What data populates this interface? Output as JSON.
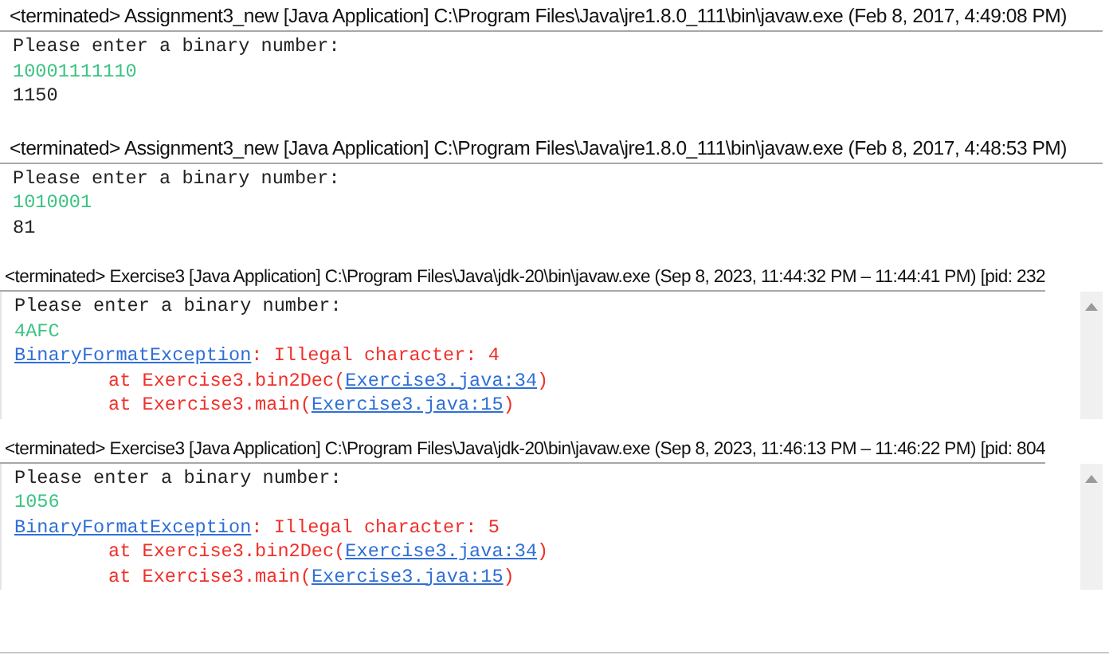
{
  "consoles": [
    {
      "header": "<terminated> Assignment3_new [Java Application] C:\\Program Files\\Java\\jre1.8.0_111\\bin\\javaw.exe (Feb 8, 2017, 4:49:08 PM)",
      "scrollbar": false,
      "lines": [
        {
          "indented": false,
          "segments": [
            {
              "kind": "output",
              "text": "Please enter a binary number:"
            }
          ]
        },
        {
          "indented": false,
          "segments": [
            {
              "kind": "input",
              "text": "10001111110"
            }
          ]
        },
        {
          "indented": false,
          "segments": [
            {
              "kind": "output",
              "text": "1150"
            }
          ]
        }
      ]
    },
    {
      "header": "<terminated> Assignment3_new [Java Application] C:\\Program Files\\Java\\jre1.8.0_111\\bin\\javaw.exe (Feb 8, 2017, 4:48:53 PM)",
      "scrollbar": false,
      "lines": [
        {
          "indented": false,
          "segments": [
            {
              "kind": "output",
              "text": "Please enter a binary number:"
            }
          ]
        },
        {
          "indented": false,
          "segments": [
            {
              "kind": "input",
              "text": "1010001"
            }
          ]
        },
        {
          "indented": false,
          "segments": [
            {
              "kind": "output",
              "text": "81"
            }
          ]
        }
      ]
    },
    {
      "header": "<terminated> Exercise3 [Java Application] C:\\Program Files\\Java\\jdk-20\\bin\\javaw.exe  (Sep 8, 2023, 11:44:32 PM – 11:44:41 PM) [pid: 232",
      "scrollbar": true,
      "lines": [
        {
          "indented": false,
          "segments": [
            {
              "kind": "output",
              "text": "Please enter a binary number:"
            }
          ]
        },
        {
          "indented": false,
          "segments": [
            {
              "kind": "input",
              "text": "4AFC"
            }
          ]
        },
        {
          "indented": false,
          "segments": [
            {
              "kind": "link",
              "text": "BinaryFormatException"
            },
            {
              "kind": "error",
              "text": ": Illegal character: 4"
            }
          ]
        },
        {
          "indented": true,
          "segments": [
            {
              "kind": "error",
              "text": "at Exercise3.bin2Dec("
            },
            {
              "kind": "link",
              "text": "Exercise3.java:34"
            },
            {
              "kind": "error",
              "text": ")"
            }
          ]
        },
        {
          "indented": true,
          "segments": [
            {
              "kind": "error",
              "text": "at Exercise3.main("
            },
            {
              "kind": "link",
              "text": "Exercise3.java:15"
            },
            {
              "kind": "error",
              "text": ")"
            }
          ]
        }
      ]
    },
    {
      "header": "<terminated> Exercise3 [Java Application] C:\\Program Files\\Java\\jdk-20\\bin\\javaw.exe  (Sep 8, 2023, 11:46:13 PM – 11:46:22 PM) [pid: 804",
      "scrollbar": true,
      "lines": [
        {
          "indented": false,
          "segments": [
            {
              "kind": "output",
              "text": "Please enter a binary number:"
            }
          ]
        },
        {
          "indented": false,
          "segments": [
            {
              "kind": "input",
              "text": "1056"
            }
          ]
        },
        {
          "indented": false,
          "segments": [
            {
              "kind": "link",
              "text": "BinaryFormatException"
            },
            {
              "kind": "error",
              "text": ": Illegal character: 5"
            }
          ]
        },
        {
          "indented": true,
          "segments": [
            {
              "kind": "error",
              "text": "at Exercise3.bin2Dec("
            },
            {
              "kind": "link",
              "text": "Exercise3.java:34"
            },
            {
              "kind": "error",
              "text": ")"
            }
          ]
        },
        {
          "indented": true,
          "segments": [
            {
              "kind": "error",
              "text": "at Exercise3.main("
            },
            {
              "kind": "link",
              "text": "Exercise3.java:15"
            },
            {
              "kind": "error",
              "text": ")"
            }
          ]
        }
      ]
    }
  ]
}
